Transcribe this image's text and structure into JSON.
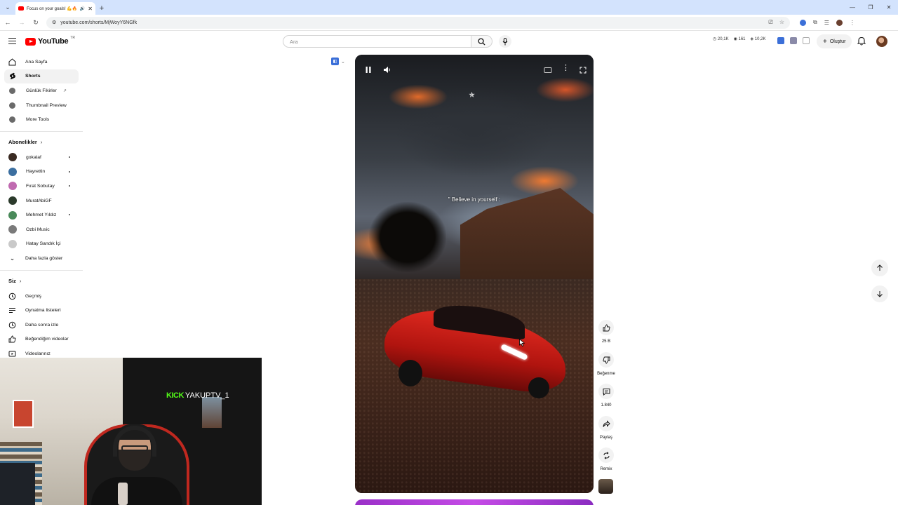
{
  "browser": {
    "tab_title": "Focus on your goals! 💪🔥",
    "url": "youtube.com/shorts/MjWoyY6NGfk"
  },
  "header": {
    "logo_text": "YouTube",
    "logo_country": "TR",
    "search_placeholder": "Ara",
    "stats": [
      "20,1K",
      "161",
      "10,2K"
    ],
    "create_label": "Oluştur"
  },
  "sidebar": {
    "main": [
      {
        "label": "Ana Sayfa",
        "icon": "home-icon"
      },
      {
        "label": "Shorts",
        "icon": "shorts-icon",
        "active": true
      }
    ],
    "tools": [
      {
        "label": "Günlük Fikirler",
        "external": true
      },
      {
        "label": "Thumbnail Preview"
      },
      {
        "label": "More Tools"
      }
    ],
    "subs_title": "Abonelikler",
    "subs": [
      {
        "label": "gokalaf",
        "color": "#3a2a22",
        "live": true
      },
      {
        "label": "Hayrettin",
        "color": "#3c6fa0",
        "live": true
      },
      {
        "label": "Fırat Sobutay",
        "color": "#c06ab0",
        "live": true
      },
      {
        "label": "MuratAbiGF",
        "color": "#2b3a2b",
        "live": false
      },
      {
        "label": "Mehmet Yıldız",
        "color": "#4a8a5a",
        "live": true
      },
      {
        "label": "Ozbi Music",
        "color": "#7a7a7a",
        "live": false
      },
      {
        "label": "Hatay Sandık İçi",
        "color": "#c9c9c9",
        "live": false
      }
    ],
    "more_label": "Daha fazla göster",
    "you_title": "Siz",
    "you": [
      {
        "label": "Geçmiş",
        "icon": "history-icon"
      },
      {
        "label": "Oynatma listeleri",
        "icon": "playlist-icon"
      },
      {
        "label": "Daha sonra izle",
        "icon": "watch-later-icon"
      },
      {
        "label": "Beğendiğim videolar",
        "icon": "like-icon"
      },
      {
        "label": "Videolarınız",
        "icon": "video-icon"
      }
    ]
  },
  "overlay": {
    "kick_brand": "KICK",
    "kick_user": "YAKUPTV_1"
  },
  "video": {
    "quote": "\" Believe in yourself :"
  },
  "actions": {
    "likes": "25 B",
    "dislike": "Beğenme",
    "comments": "1.840",
    "share": "Paylaş",
    "remix": "Remix"
  }
}
